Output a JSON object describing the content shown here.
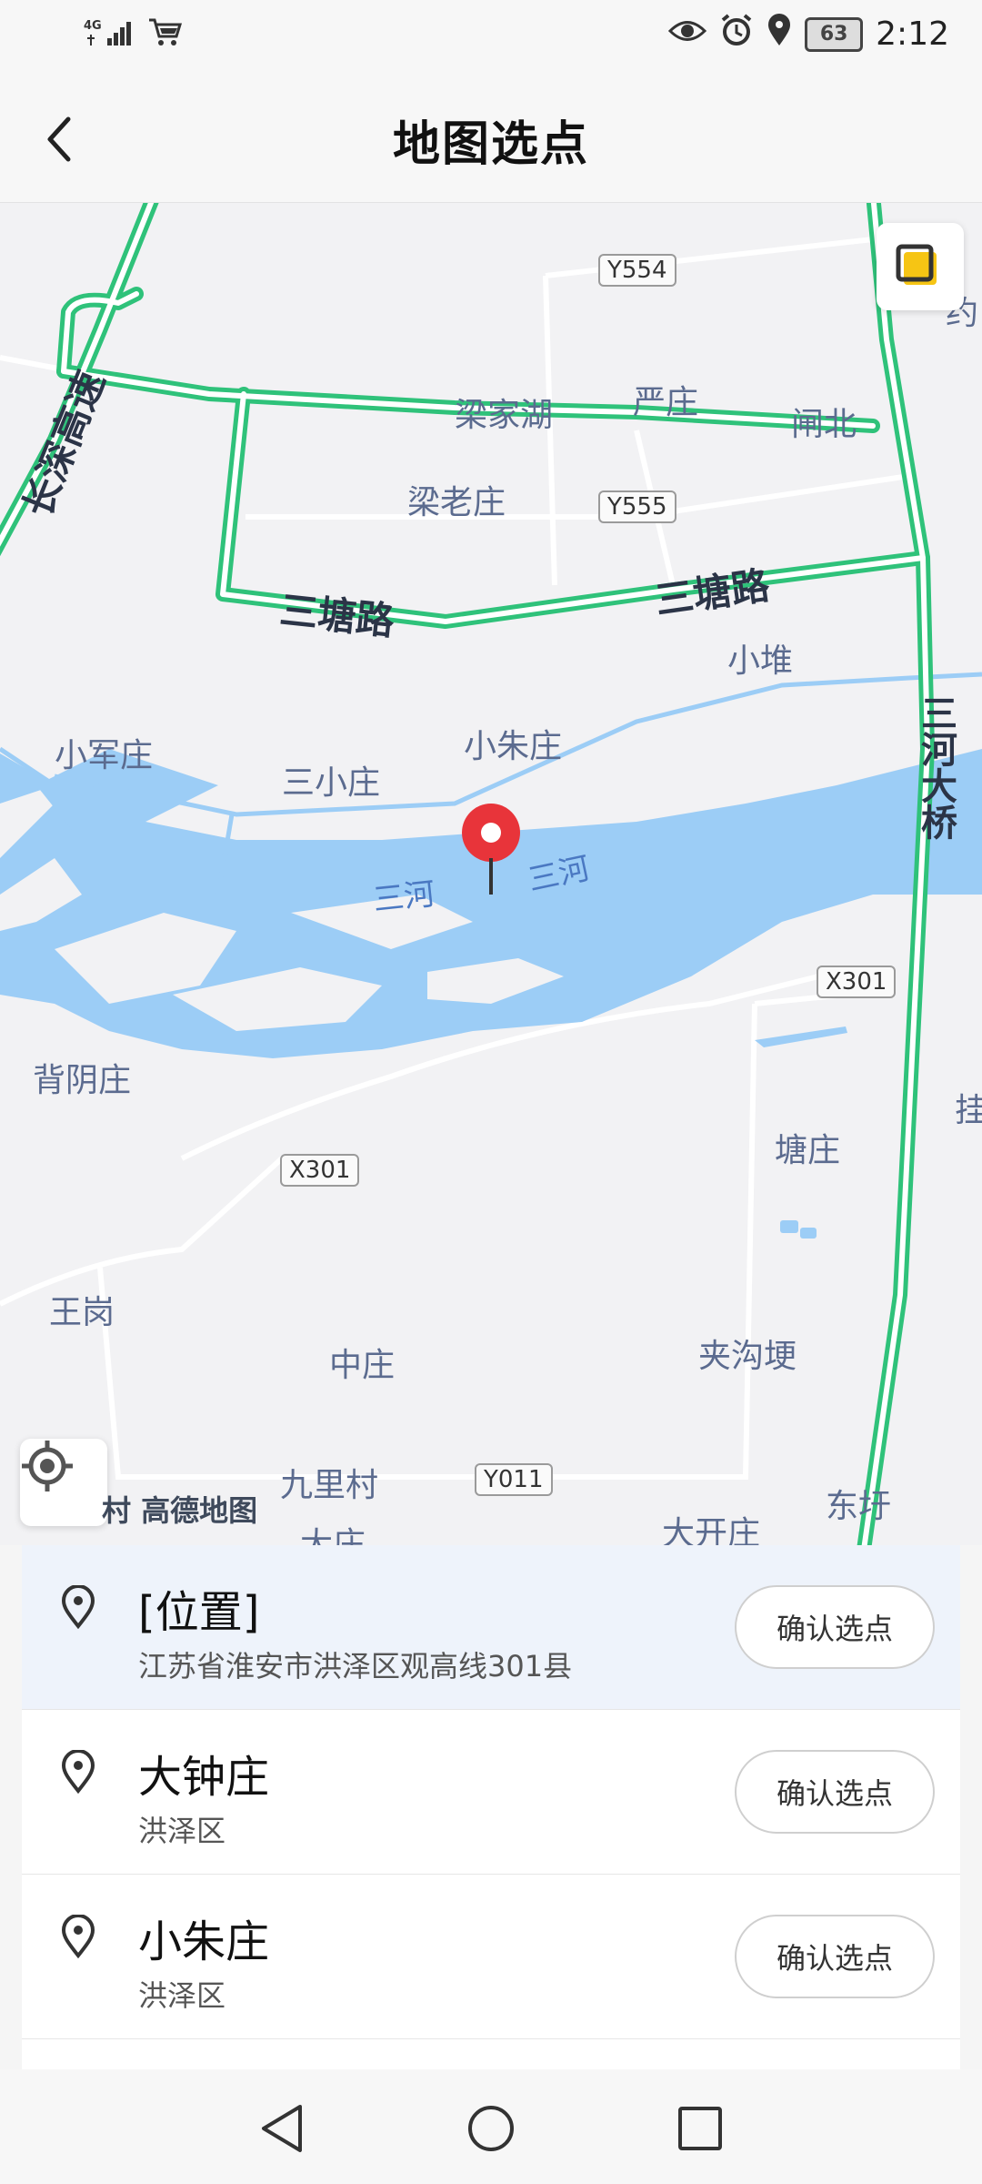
{
  "status_bar": {
    "network": "4G",
    "time": "2:12",
    "battery": "63"
  },
  "header": {
    "title": "地图选点"
  },
  "map": {
    "watermark": "村 高德地图",
    "pin_color": "#e8343a",
    "road_color": "#2fc27a",
    "water_color": "#9ccdf6",
    "road_labels": [
      {
        "text": "长深高速"
      },
      {
        "text": "三塘路"
      },
      {
        "text": "三塘路"
      },
      {
        "text": "三河大桥"
      }
    ],
    "shields": [
      "Y554",
      "Y555",
      "X301",
      "X301",
      "Y011"
    ],
    "places": [
      "梁家湖",
      "严庄",
      "闸北",
      "梁老庄",
      "小堆",
      "小军庄",
      "三小庄",
      "小朱庄",
      "背阴庄",
      "塘庄",
      "王岗",
      "中庄",
      "夹沟埂",
      "九里村",
      "大庄",
      "大开庄",
      "东圩",
      "挂",
      "约"
    ],
    "river_labels": [
      "三河",
      "三河"
    ]
  },
  "results": [
    {
      "name": "[位置]",
      "address": "江苏省淮安市洪泽区观高线301县",
      "button": "确认选点",
      "selected": true
    },
    {
      "name": "大钟庄",
      "address": "洪泽区",
      "button": "确认选点",
      "selected": false
    },
    {
      "name": "小朱庄",
      "address": "洪泽区",
      "button": "确认选点",
      "selected": false
    }
  ]
}
